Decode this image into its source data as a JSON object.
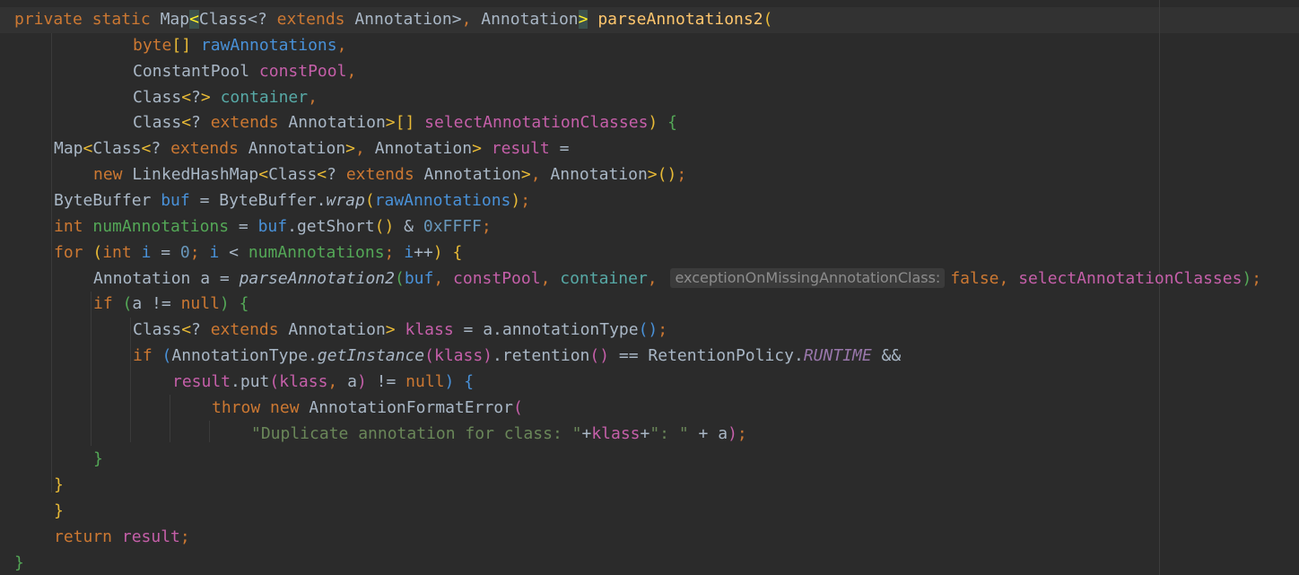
{
  "editor": {
    "lines": [
      {
        "indent": 0,
        "tokens": [
          {
            "t": "private static ",
            "c": "kw"
          },
          {
            "t": "Map"
          },
          {
            "t": "<",
            "c": "bm"
          },
          {
            "t": "Class<"
          },
          {
            "t": "? ",
            "c": "loc"
          },
          {
            "t": "extends ",
            "c": "kw"
          },
          {
            "t": "Annotation>"
          },
          {
            "t": ", ",
            "c": "kw"
          },
          {
            "t": "Annotation"
          },
          {
            "t": ">",
            "c": "bm"
          },
          {
            "t": " "
          },
          {
            "t": "parseAnnotations2",
            "c": "fn"
          },
          {
            "t": "(",
            "c": "y"
          }
        ]
      },
      {
        "indent": 3,
        "tokens": [
          {
            "t": "byte",
            "c": "kw"
          },
          {
            "t": "[] ",
            "c": "y"
          },
          {
            "t": "rawAnnotations",
            "c": "b"
          },
          {
            "t": ",",
            "c": "kw"
          }
        ]
      },
      {
        "indent": 3,
        "tokens": [
          {
            "t": "ConstantPool "
          },
          {
            "t": "constPool",
            "c": "pk"
          },
          {
            "t": ",",
            "c": "kw"
          }
        ]
      },
      {
        "indent": 3,
        "tokens": [
          {
            "t": "Class"
          },
          {
            "t": "<",
            "c": "y"
          },
          {
            "t": "?"
          },
          {
            "t": "> ",
            "c": "y"
          },
          {
            "t": "container",
            "c": "tl"
          },
          {
            "t": ",",
            "c": "kw"
          }
        ]
      },
      {
        "indent": 3,
        "tokens": [
          {
            "t": "Class"
          },
          {
            "t": "<",
            "c": "y"
          },
          {
            "t": "? "
          },
          {
            "t": "extends ",
            "c": "kw"
          },
          {
            "t": "Annotation"
          },
          {
            "t": ">[] ",
            "c": "y"
          },
          {
            "t": "selectAnnotationClasses",
            "c": "pk"
          },
          {
            "t": ") ",
            "c": "y"
          },
          {
            "t": "{",
            "c": "g"
          }
        ]
      },
      {
        "indent": 1,
        "tokens": [
          {
            "t": "Map"
          },
          {
            "t": "<",
            "c": "y"
          },
          {
            "t": "Class"
          },
          {
            "t": "<",
            "c": "y"
          },
          {
            "t": "? "
          },
          {
            "t": "extends ",
            "c": "kw"
          },
          {
            "t": "Annotation"
          },
          {
            "t": ">",
            "c": "y"
          },
          {
            "t": ", ",
            "c": "kw"
          },
          {
            "t": "Annotation"
          },
          {
            "t": "> ",
            "c": "y"
          },
          {
            "t": "result",
            "c": "pk"
          },
          {
            "t": " ="
          }
        ]
      },
      {
        "indent": 2,
        "tokens": [
          {
            "t": "new ",
            "c": "kw"
          },
          {
            "t": "LinkedHashMap"
          },
          {
            "t": "<",
            "c": "y"
          },
          {
            "t": "Class"
          },
          {
            "t": "<",
            "c": "y"
          },
          {
            "t": "? "
          },
          {
            "t": "extends ",
            "c": "kw"
          },
          {
            "t": "Annotation"
          },
          {
            "t": ">",
            "c": "y"
          },
          {
            "t": ", ",
            "c": "kw"
          },
          {
            "t": "Annotation"
          },
          {
            "t": ">",
            "c": "y"
          },
          {
            "t": "()",
            "c": "y"
          },
          {
            "t": ";",
            "c": "kw"
          }
        ]
      },
      {
        "indent": 1,
        "tokens": [
          {
            "t": "ByteBuffer "
          },
          {
            "t": "buf",
            "c": "b"
          },
          {
            "t": " = ByteBuffer."
          },
          {
            "t": "wrap",
            "c": "static"
          },
          {
            "t": "(",
            "c": "y"
          },
          {
            "t": "rawAnnotations",
            "c": "b"
          },
          {
            "t": ")",
            "c": "y"
          },
          {
            "t": ";",
            "c": "kw"
          }
        ]
      },
      {
        "indent": 1,
        "tokens": [
          {
            "t": "int ",
            "c": "kw"
          },
          {
            "t": "numAnnotations",
            "c": "g"
          },
          {
            "t": " = "
          },
          {
            "t": "buf",
            "c": "b"
          },
          {
            "t": ".getShort"
          },
          {
            "t": "()",
            "c": "y"
          },
          {
            "t": " & "
          },
          {
            "t": "0xFFFF",
            "c": "num"
          },
          {
            "t": ";",
            "c": "kw"
          }
        ]
      },
      {
        "indent": 1,
        "tokens": [
          {
            "t": "for ",
            "c": "kw"
          },
          {
            "t": "(",
            "c": "y"
          },
          {
            "t": "int ",
            "c": "kw"
          },
          {
            "t": "i",
            "c": "b"
          },
          {
            "t": " = "
          },
          {
            "t": "0",
            "c": "num"
          },
          {
            "t": "; ",
            "c": "kw"
          },
          {
            "t": "i",
            "c": "b"
          },
          {
            "t": " < "
          },
          {
            "t": "numAnnotations",
            "c": "g"
          },
          {
            "t": "; ",
            "c": "kw"
          },
          {
            "t": "i",
            "c": "b"
          },
          {
            "t": "++"
          },
          {
            "t": ") ",
            "c": "y"
          },
          {
            "t": "{",
            "c": "y"
          }
        ]
      },
      {
        "indent": 2,
        "tokens": [
          {
            "t": "Annotation "
          },
          {
            "t": "a"
          },
          {
            "t": " = "
          },
          {
            "t": "parseAnnotation2",
            "c": "static"
          },
          {
            "t": "(",
            "c": "g"
          },
          {
            "t": "buf",
            "c": "b"
          },
          {
            "t": ", ",
            "c": "kw"
          },
          {
            "t": "constPool",
            "c": "pk"
          },
          {
            "t": ", ",
            "c": "kw"
          },
          {
            "t": "container",
            "c": "tl"
          },
          {
            "t": ", ",
            "c": "kw"
          },
          {
            "hint": "exceptionOnMissingAnnotationClass:"
          },
          {
            "t": "false",
            "c": "kw"
          },
          {
            "t": ", ",
            "c": "kw"
          },
          {
            "t": "selectAnnotationClasses",
            "c": "pk"
          },
          {
            "t": ")",
            "c": "g"
          },
          {
            "t": ";",
            "c": "kw"
          }
        ]
      },
      {
        "indent": 2,
        "tokens": [
          {
            "t": "if ",
            "c": "kw"
          },
          {
            "t": "(",
            "c": "g"
          },
          {
            "t": "a"
          },
          {
            "t": " != "
          },
          {
            "t": "null",
            "c": "kw"
          },
          {
            "t": ") ",
            "c": "g"
          },
          {
            "t": "{",
            "c": "g"
          }
        ]
      },
      {
        "indent": 3,
        "tokens": [
          {
            "t": "Class"
          },
          {
            "t": "<",
            "c": "y"
          },
          {
            "t": "? "
          },
          {
            "t": "extends ",
            "c": "kw"
          },
          {
            "t": "Annotation"
          },
          {
            "t": "> ",
            "c": "y"
          },
          {
            "t": "klass",
            "c": "pk"
          },
          {
            "t": " = "
          },
          {
            "t": "a"
          },
          {
            "t": ".annotationType"
          },
          {
            "t": "()",
            "c": "b"
          },
          {
            "t": ";",
            "c": "kw"
          }
        ]
      },
      {
        "indent": 3,
        "tokens": [
          {
            "t": "if ",
            "c": "kw"
          },
          {
            "t": "(",
            "c": "b"
          },
          {
            "t": "AnnotationType."
          },
          {
            "t": "getInstance",
            "c": "static"
          },
          {
            "t": "(",
            "c": "pk"
          },
          {
            "t": "klass",
            "c": "pk"
          },
          {
            "t": ")",
            "c": "pk"
          },
          {
            "t": ".retention"
          },
          {
            "t": "()",
            "c": "pk"
          },
          {
            "t": " == RetentionPolicy."
          },
          {
            "t": "RUNTIME",
            "c": "const"
          },
          {
            "t": " &&"
          }
        ]
      },
      {
        "indent": 4,
        "tokens": [
          {
            "t": "result",
            "c": "pk"
          },
          {
            "t": ".put"
          },
          {
            "t": "(",
            "c": "pk"
          },
          {
            "t": "klass",
            "c": "pk"
          },
          {
            "t": ", ",
            "c": "kw"
          },
          {
            "t": "a"
          },
          {
            "t": ")",
            "c": "pk"
          },
          {
            "t": " != "
          },
          {
            "t": "null",
            "c": "kw"
          },
          {
            "t": ") ",
            "c": "b"
          },
          {
            "t": "{",
            "c": "b"
          }
        ]
      },
      {
        "indent": 5,
        "tokens": [
          {
            "t": "throw new ",
            "c": "kw"
          },
          {
            "t": "AnnotationFormatError"
          },
          {
            "t": "(",
            "c": "pk"
          }
        ]
      },
      {
        "indent": 6,
        "tokens": [
          {
            "t": "\"Duplicate annotation for class: \"",
            "c": "str"
          },
          {
            "t": "+"
          },
          {
            "t": "klass",
            "c": "pk"
          },
          {
            "t": "+"
          },
          {
            "t": "\": \"",
            "c": "str"
          },
          {
            "t": " + "
          },
          {
            "t": "a"
          },
          {
            "t": ")",
            "c": "pk"
          },
          {
            "t": ";",
            "c": "kw"
          }
        ]
      },
      {
        "indent": 2,
        "tokens": [
          {
            "t": "}",
            "c": "g"
          }
        ]
      },
      {
        "indent": 1,
        "tokens": [
          {
            "t": "}",
            "c": "y"
          }
        ]
      },
      {
        "indent": 1,
        "tokens": [
          {
            "t": "}",
            "c": "y"
          }
        ]
      },
      {
        "indent": 1,
        "tokens": [
          {
            "t": "return ",
            "c": "kw"
          },
          {
            "t": "result",
            "c": "pk"
          },
          {
            "t": ";",
            "c": "kw"
          }
        ]
      },
      {
        "indent": 0,
        "tokens": [
          {
            "t": "}",
            "c": "g"
          }
        ]
      }
    ]
  }
}
